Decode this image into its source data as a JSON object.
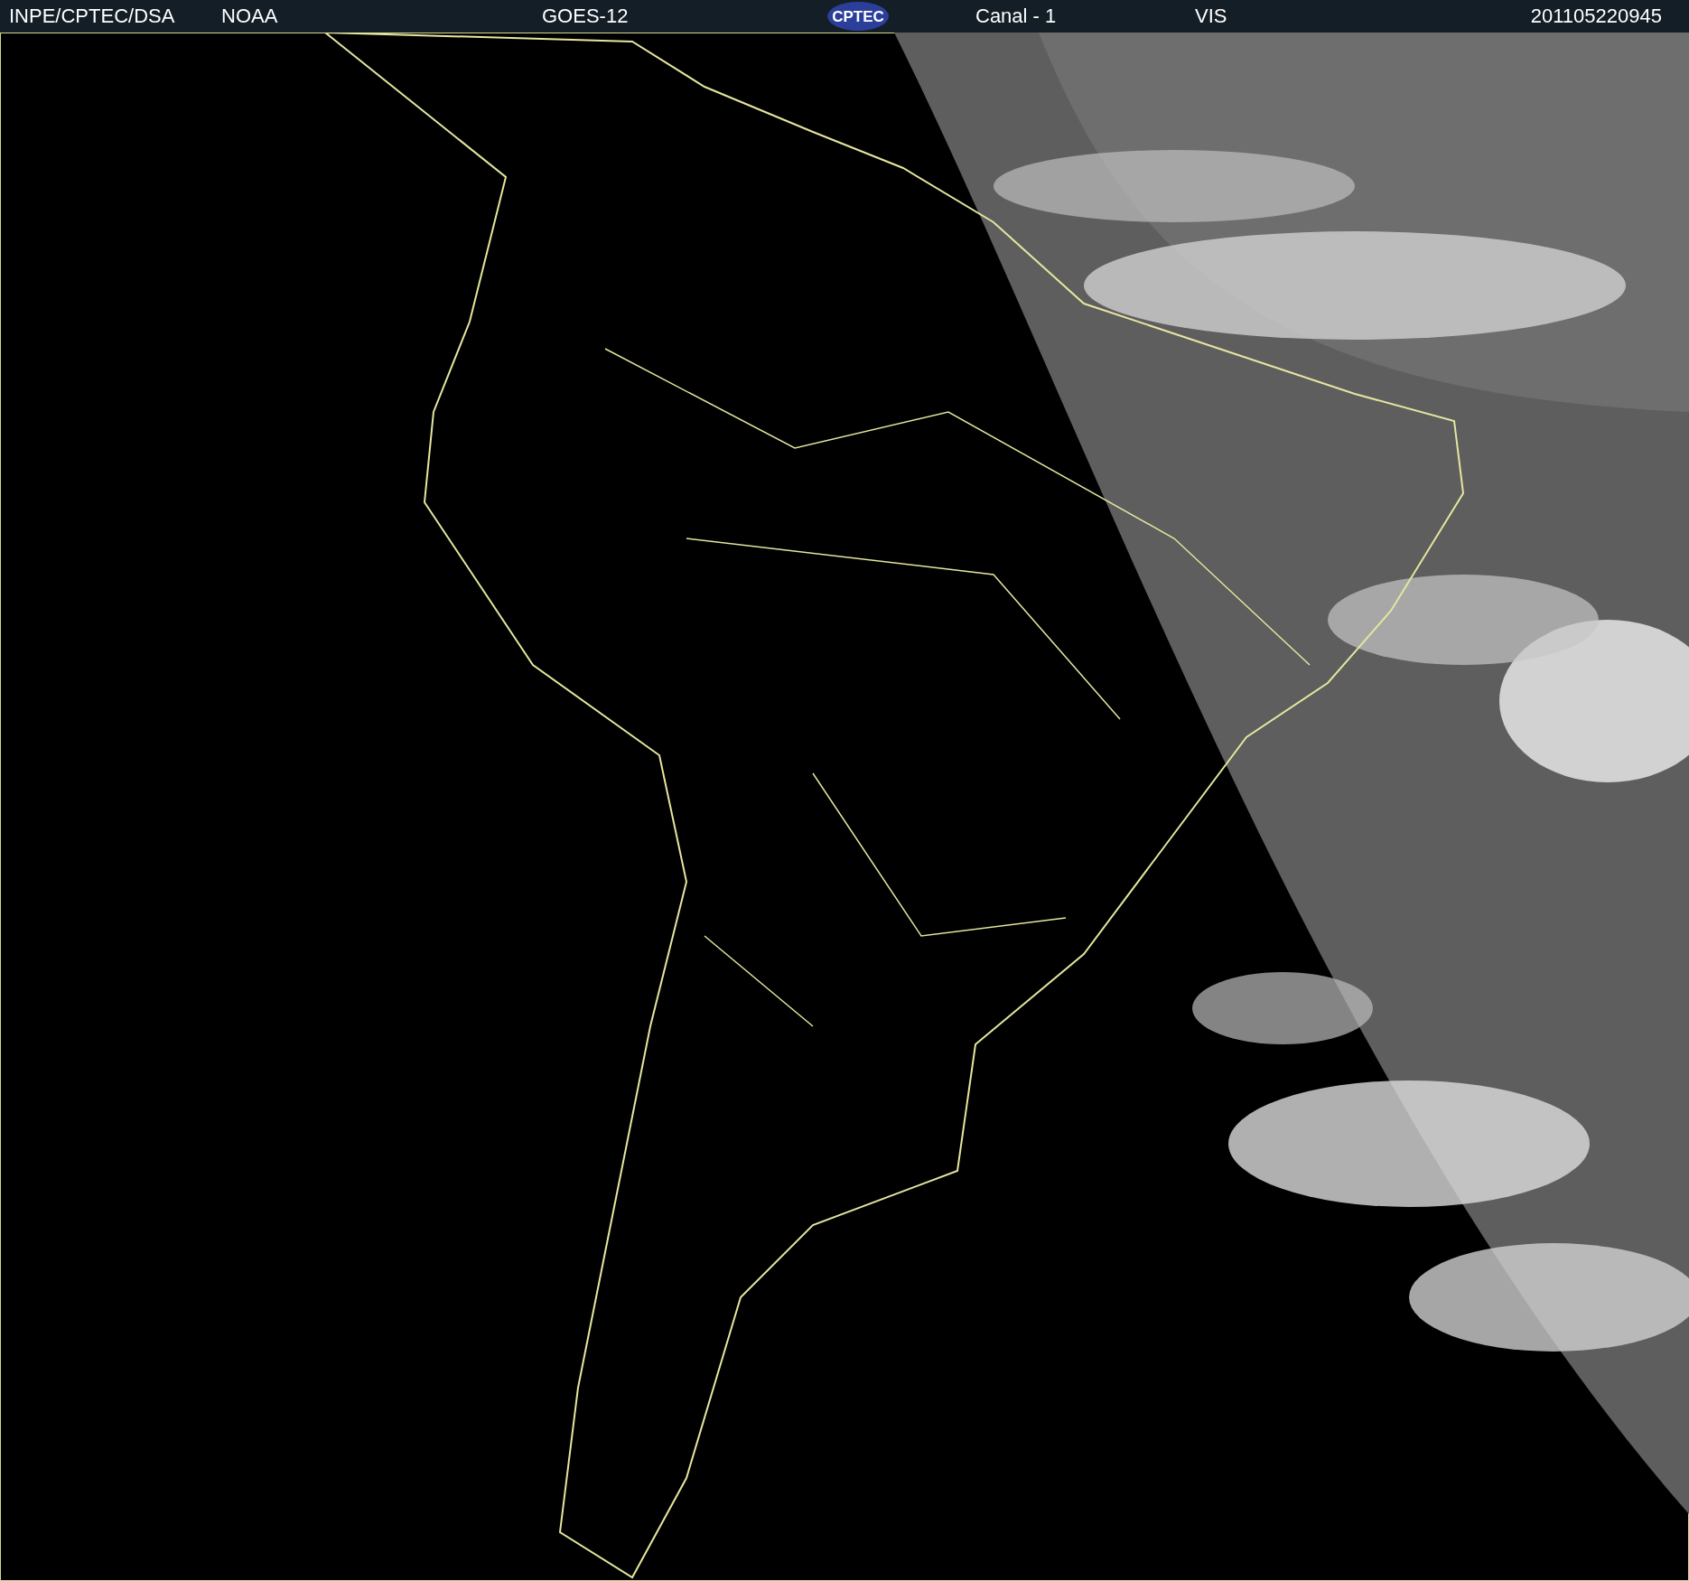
{
  "header": {
    "source": "INPE/CPTEC/DSA",
    "agency": "NOAA",
    "satellite": "GOES-12",
    "logo_text": "CPTEC",
    "channel": "Canal - 1",
    "band": "VIS",
    "timestamp": "201105220945"
  }
}
